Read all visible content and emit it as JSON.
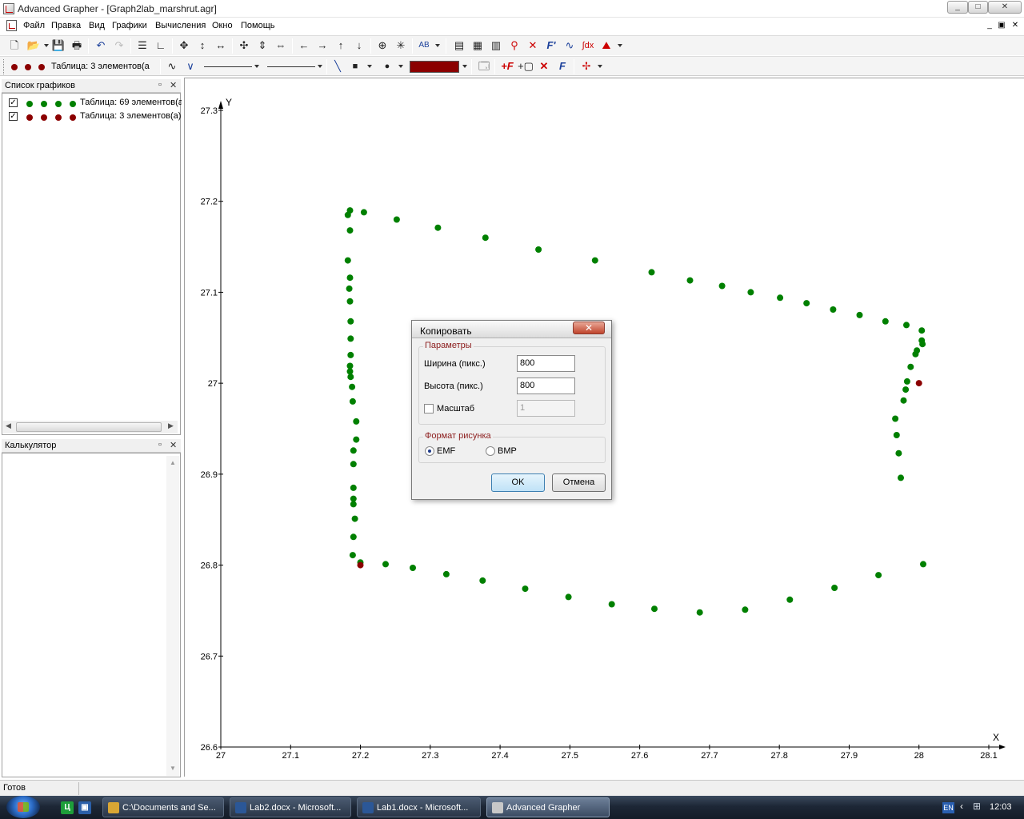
{
  "window": {
    "title": "Advanced Grapher - [Graph2lab_marshrut.agr]",
    "controls": {
      "minimize": "_",
      "maximize": "□",
      "close": "✕"
    }
  },
  "menubar": {
    "items": [
      "Файл",
      "Правка",
      "Вид",
      "Графики",
      "Вычисления",
      "Окно",
      "Помощь"
    ],
    "mdi_controls": {
      "minimize": "_",
      "restore": "▣",
      "close": "✕"
    }
  },
  "toolbar2": {
    "current_graph_label": "Таблица: 3 элементов(а",
    "dot_color": "#8b0000",
    "fill_color": "#8b0000"
  },
  "graph_list": {
    "title": "Список графиков",
    "items": [
      {
        "checked": true,
        "color": "#008000",
        "label": "Таблица: 69 элементов(а"
      },
      {
        "checked": true,
        "color": "#8b0000",
        "label": "Таблица: 3 элементов(а)"
      }
    ]
  },
  "calculator": {
    "title": "Калькулятор"
  },
  "chart_data": {
    "type": "scatter",
    "xlabel": "X",
    "ylabel": "Y",
    "xlim": [
      27,
      28.1
    ],
    "ylim": [
      26.6,
      27.3
    ],
    "xticks": [
      "27",
      "27.1",
      "27.2",
      "27.3",
      "27.4",
      "27.5",
      "27.6",
      "27.7",
      "27.8",
      "27.9",
      "28",
      "28.1"
    ],
    "yticks": [
      "26.6",
      "26.7",
      "26.8",
      "26.9",
      "27",
      "27.1",
      "27.2",
      "27.3"
    ],
    "grid": false,
    "series": [
      {
        "color": "#008000",
        "points": [
          [
            27.185,
            27.19
          ],
          [
            27.205,
            27.188
          ],
          [
            27.252,
            27.18
          ],
          [
            27.311,
            27.171
          ],
          [
            27.379,
            27.16
          ],
          [
            27.455,
            27.147
          ],
          [
            27.536,
            27.135
          ],
          [
            27.617,
            27.122
          ],
          [
            27.672,
            27.113
          ],
          [
            27.718,
            27.107
          ],
          [
            27.759,
            27.1
          ],
          [
            27.801,
            27.094
          ],
          [
            27.839,
            27.088
          ],
          [
            27.877,
            27.081
          ],
          [
            27.915,
            27.075
          ],
          [
            27.952,
            27.068
          ],
          [
            27.982,
            27.064
          ],
          [
            28.004,
            27.058
          ],
          [
            28.004,
            27.047
          ],
          [
            28.005,
            27.043
          ],
          [
            27.997,
            27.036
          ],
          [
            27.995,
            27.032
          ],
          [
            27.988,
            27.018
          ],
          [
            27.983,
            27.002
          ],
          [
            27.981,
            26.993
          ],
          [
            27.978,
            26.981
          ],
          [
            27.966,
            26.961
          ],
          [
            27.968,
            26.943
          ],
          [
            27.971,
            26.923
          ],
          [
            27.974,
            26.896
          ],
          [
            28.006,
            26.801
          ],
          [
            27.942,
            26.789
          ],
          [
            27.879,
            26.775
          ],
          [
            27.815,
            26.762
          ],
          [
            27.751,
            26.751
          ],
          [
            27.686,
            26.748
          ],
          [
            27.621,
            26.752
          ],
          [
            27.56,
            26.757
          ],
          [
            27.498,
            26.765
          ],
          [
            27.436,
            26.774
          ],
          [
            27.375,
            26.783
          ],
          [
            27.323,
            26.79
          ],
          [
            27.275,
            26.797
          ],
          [
            27.236,
            26.801
          ],
          [
            27.2,
            26.803
          ],
          [
            27.189,
            26.811
          ],
          [
            27.19,
            26.831
          ],
          [
            27.192,
            26.851
          ],
          [
            27.19,
            26.867
          ],
          [
            27.19,
            26.873
          ],
          [
            27.19,
            26.885
          ],
          [
            27.19,
            26.911
          ],
          [
            27.19,
            26.926
          ],
          [
            27.194,
            26.938
          ],
          [
            27.194,
            26.958
          ],
          [
            27.189,
            26.98
          ],
          [
            27.188,
            26.996
          ],
          [
            27.186,
            27.007
          ],
          [
            27.185,
            27.013
          ],
          [
            27.185,
            27.019
          ],
          [
            27.186,
            27.031
          ],
          [
            27.186,
            27.049
          ],
          [
            27.186,
            27.068
          ],
          [
            27.185,
            27.09
          ],
          [
            27.184,
            27.104
          ],
          [
            27.185,
            27.116
          ],
          [
            27.182,
            27.135
          ],
          [
            27.185,
            27.168
          ],
          [
            27.182,
            27.185
          ]
        ]
      },
      {
        "color": "#8b0000",
        "points": [
          [
            28.0,
            27.0
          ],
          [
            27.2,
            26.8
          ]
        ]
      }
    ]
  },
  "dialog": {
    "title": "Копировать",
    "params_group": "Параметры",
    "width_label": "Ширина (пикс.)",
    "width_value": "800",
    "height_label": "Высота (пикс.)",
    "height_value": "800",
    "scale_label": "Масштаб",
    "scale_checked": false,
    "scale_value": "1",
    "format_group": "Формат рисунка",
    "format_options": [
      "EMF",
      "BMP"
    ],
    "format_selected": "EMF",
    "ok_label": "OK",
    "cancel_label": "Отмена"
  },
  "status": {
    "text": "Готов"
  },
  "taskbar": {
    "tasks": [
      {
        "label": "C:\\Documents and Se...",
        "icon_color": "#d9a634"
      },
      {
        "label": "Lab2.docx - Microsoft...",
        "icon_color": "#2b5797"
      },
      {
        "label": "Lab1.docx - Microsoft...",
        "icon_color": "#2b5797"
      },
      {
        "label": "Advanced Grapher",
        "icon_color": "#c8c8c8",
        "active": true
      }
    ],
    "language": "EN",
    "time": "12:03"
  }
}
